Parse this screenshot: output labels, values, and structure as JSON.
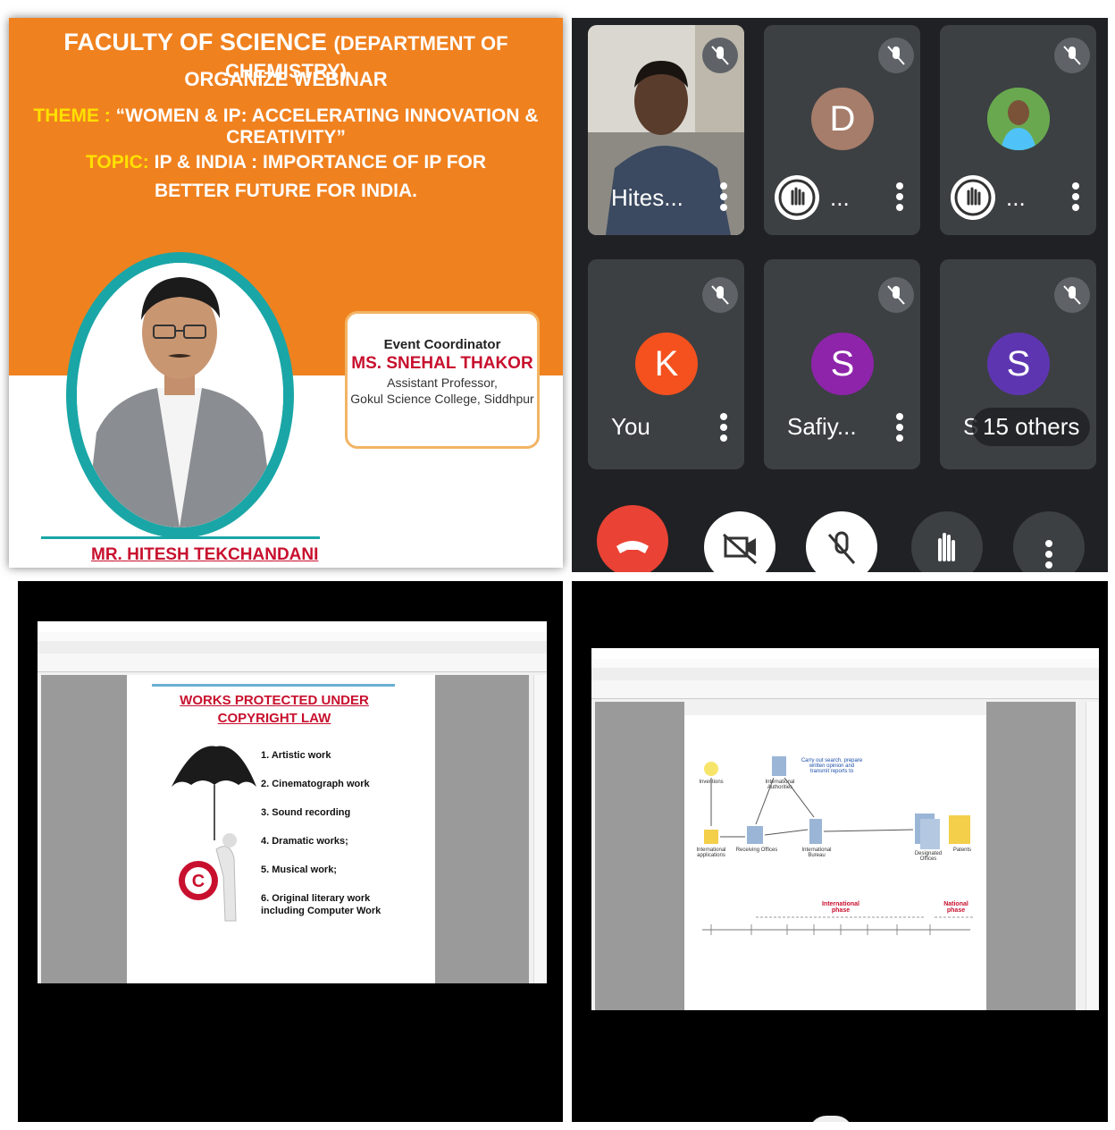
{
  "poster": {
    "title_main": "FACULTY OF SCIENCE",
    "title_sub": "(DEPARTMENT OF CHEMISTRY)",
    "organize": "ORGANIZE WEBINAR",
    "theme_label": "THEME :",
    "theme_text": "“WOMEN & IP: ACCELERATING INNOVATION & CREATIVITY”",
    "topic_label": "TOPIC:",
    "topic_line1": "IP & INDIA : IMPORTANCE OF IP FOR",
    "topic_line2": "BETTER FUTURE FOR INDIA.",
    "speaker_name": "MR. HITESH TEKCHANDANI",
    "coordinator": {
      "heading": "Event Coordinator",
      "name": "MS. SNEHAL THAKOR",
      "role": "Assistant Professor,",
      "college": "Gokul Science College, Siddhpur"
    },
    "colors": {
      "orange": "#f0811f",
      "teal": "#1aa6a6",
      "red": "#c8102e",
      "yellow": "#ffe000"
    }
  },
  "meet": {
    "tiles": [
      {
        "name": "Hites...",
        "type": "video"
      },
      {
        "name": "...",
        "initial": "D",
        "avatar_color": "#a67c6a",
        "hand_raised": true
      },
      {
        "name": "...",
        "type": "photo",
        "hand_raised": true
      },
      {
        "name": "You",
        "initial": "K",
        "avatar_color": "#f4511e"
      },
      {
        "name": "Safiy...",
        "initial": "S",
        "avatar_color": "#8e24aa"
      },
      {
        "name": "S",
        "initial": "S",
        "avatar_color": "#5e35b1",
        "overlay": "15 others"
      }
    ],
    "controls": [
      "end-call-icon",
      "camera-off-icon",
      "mic-off-icon",
      "raise-hand-icon",
      "more-options-icon"
    ],
    "colors": {
      "bg": "#202124",
      "tile": "#3c4043",
      "end_call": "#ea4335"
    }
  },
  "pdf1": {
    "title_line1": "WORKS PROTECTED UNDER",
    "title_line2": "COPYRIGHT LAW",
    "items": [
      "1. Artistic work",
      "2. Cinematograph work",
      "3. Sound recording",
      "4. Dramatic works;",
      "5. Musical work;",
      "6. Original literary work",
      "including Computer Work"
    ]
  },
  "pdf2": {
    "labels": {
      "inventions": "Inventions",
      "intl_authorities": "International Authorities",
      "search_text": "Carry out search, prepare written opinion and transmit reports to",
      "intl_applications": "International applications",
      "receiving_offices": "Receiving Offices",
      "intl_bureau": "International Bureau",
      "designated": "Designated Offices",
      "patents": "Patents",
      "international_phase": "International phase",
      "national_phase": "National phase"
    }
  }
}
